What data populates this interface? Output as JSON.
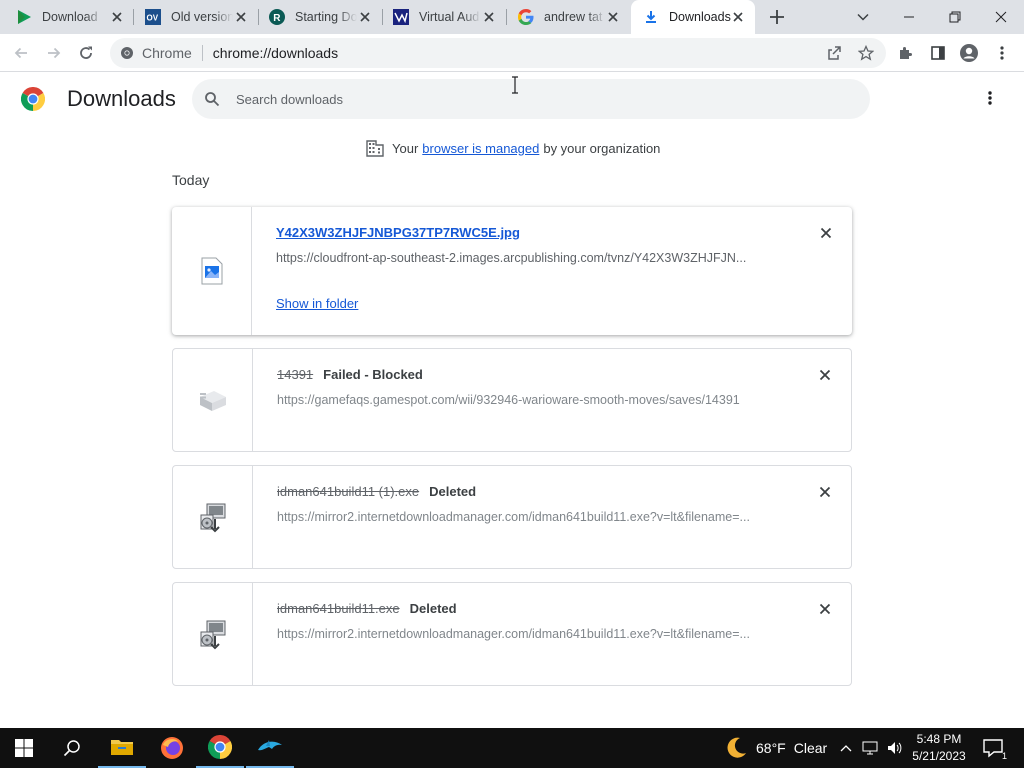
{
  "browser": {
    "tabs": [
      {
        "title": "Download",
        "favicon": "play-icon"
      },
      {
        "title": "Old version",
        "favicon": "ov-icon"
      },
      {
        "title": "Starting Do",
        "favicon": "r-icon"
      },
      {
        "title": "Virtual Aud",
        "favicon": "va-icon"
      },
      {
        "title": "andrew tat",
        "favicon": "google-icon"
      },
      {
        "title": "Downloads",
        "favicon": "download-icon",
        "active": true
      }
    ],
    "omnibox": {
      "site_label": "Chrome",
      "url": "chrome://downloads"
    }
  },
  "downloads_page": {
    "title": "Downloads",
    "search_placeholder": "Search downloads",
    "managed": {
      "prefix": "Your",
      "link": "browser is managed",
      "suffix": "by your organization"
    },
    "section_label": "Today",
    "items": [
      {
        "filename": "Y42X3W3ZHJFJNBPG37TP7RWC5E.jpg",
        "status": "",
        "url": "https://cloudfront-ap-southeast-2.images.arcpublishing.com/tvnz/Y42X3W3ZHJFJN...",
        "action": "Show in folder",
        "icon": "image-file-icon"
      },
      {
        "filename": "14391",
        "status": "Failed - Blocked",
        "url": "https://gamefaqs.gamespot.com/wii/932946-warioware-smooth-moves/saves/14391",
        "icon": "blocked-file-icon"
      },
      {
        "filename": "idman641build11 (1).exe",
        "status": "Deleted",
        "url": "https://mirror2.internetdownloadmanager.com/idman641build11.exe?v=lt&filename=...",
        "icon": "installer-icon"
      },
      {
        "filename": "idman641build11.exe",
        "status": "Deleted",
        "url": "https://mirror2.internetdownloadmanager.com/idman641build11.exe?v=lt&filename=...",
        "icon": "installer-icon"
      }
    ]
  },
  "taskbar": {
    "weather": {
      "temp": "68°F",
      "condition": "Clear"
    },
    "clock": {
      "time": "5:48 PM",
      "date": "5/21/2023"
    },
    "notification_count": "1"
  },
  "colors": {
    "link": "#1558d6",
    "tabstrip": "#dee1e6",
    "taskbar": "#101010"
  }
}
